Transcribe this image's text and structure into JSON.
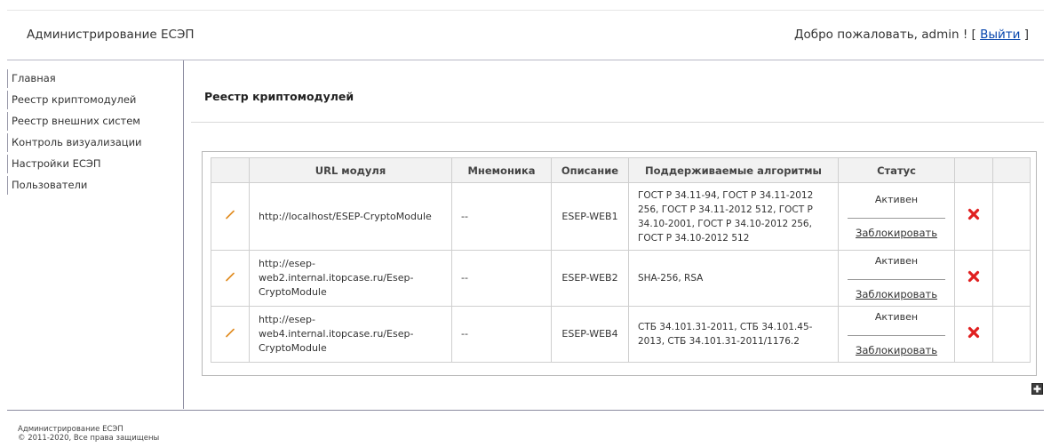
{
  "header": {
    "app_title": "Администрирование ЕСЭП",
    "welcome_prefix": "Добро пожаловать, admin ! [ ",
    "logout_label": "Выйти",
    "welcome_suffix": " ]"
  },
  "sidebar": {
    "items": [
      {
        "label": "Главная"
      },
      {
        "label": "Реестр криптомодулей"
      },
      {
        "label": "Реестр внешних систем"
      },
      {
        "label": "Контроль визуализации"
      },
      {
        "label": "Настройки ЕСЭП"
      },
      {
        "label": "Пользователи"
      }
    ]
  },
  "main": {
    "title": "Реестр криптомодулей",
    "table": {
      "columns": [
        "URL модуля",
        "Мнемоника",
        "Описание",
        "Поддерживаемые алгоритмы",
        "Статус"
      ],
      "rows": [
        {
          "url": "http://localhost/ESEP-CryptoModule",
          "mnemonic": "--",
          "description": "ESEP-WEB1",
          "algorithms": "ГОСТ Р 34.11-94, ГОСТ Р 34.11-2012 256, ГОСТ Р 34.11-2012 512, ГОСТ Р 34.10-2001, ГОСТ Р 34.10-2012 256, ГОСТ Р 34.10-2012 512",
          "status": "Активен",
          "action": "Заблокировать"
        },
        {
          "url": "http://esep-web2.internal.itopcase.ru/Esep-CryptoModule",
          "mnemonic": "--",
          "description": "ESEP-WEB2",
          "algorithms": "SHA-256, RSA",
          "status": "Активен",
          "action": "Заблокировать"
        },
        {
          "url": "http://esep-web4.internal.itopcase.ru/Esep-CryptoModule",
          "mnemonic": "--",
          "description": "ESEP-WEB4",
          "algorithms": "СТБ 34.101.31-2011, СТБ 34.101.45-2013, СТБ 34.101.31-2011/1176.2",
          "status": "Активен",
          "action": "Заблокировать"
        }
      ]
    }
  },
  "icons": {
    "edit": "pencil-icon",
    "delete": "red-x-icon",
    "add": "plus-icon"
  },
  "colors": {
    "link": "#0645ad",
    "delete_red": "#e02020",
    "pencil": "#e08a1e"
  },
  "footer": {
    "line1": "Администрирование ЕСЭП",
    "line2": "© 2011-2020, Все права защищены"
  }
}
